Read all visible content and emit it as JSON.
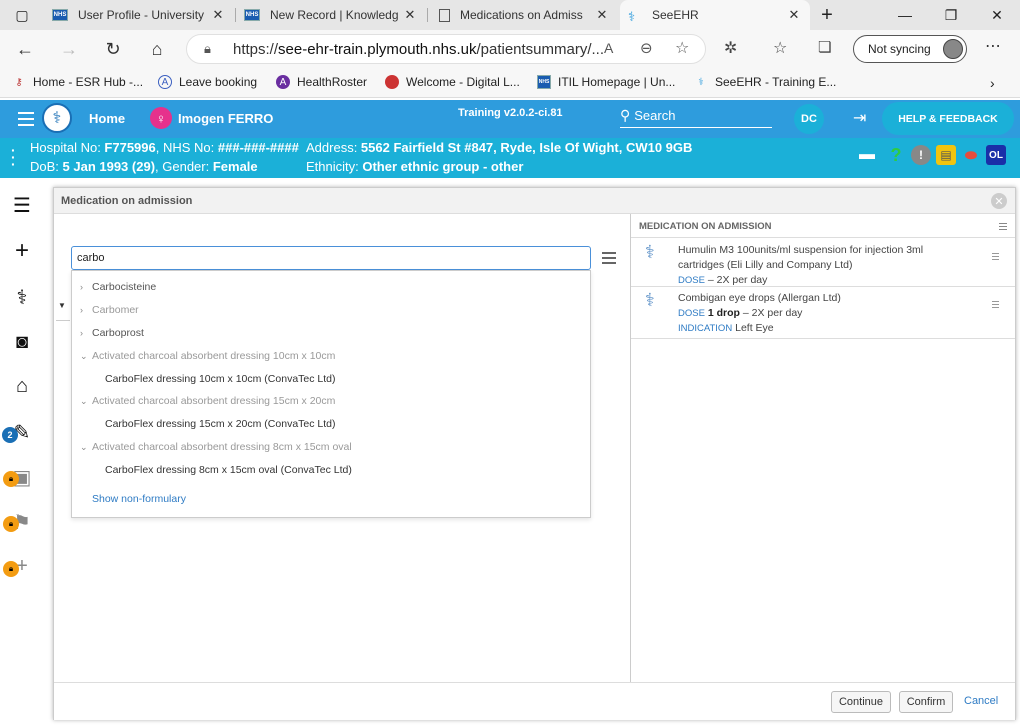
{
  "browser": {
    "tabs": [
      {
        "title": "User Profile - University",
        "favicon": "nhs-icon"
      },
      {
        "title": "New Record | Knowledg",
        "favicon": "nhs-icon"
      },
      {
        "title": "Medications on Admiss",
        "favicon": "page-icon"
      },
      {
        "title": "SeeEHR",
        "favicon": "seeehr-icon"
      }
    ],
    "url_prefix": "https://",
    "url_host": "see-ehr-train.plymouth.nhs.uk",
    "url_path": "/patientsummary/...",
    "sync_label": "Not syncing",
    "bookmarks": [
      "Home - ESR Hub -...",
      "Leave booking",
      "HealthRoster",
      "Welcome - Digital L...",
      "ITIL Homepage | Un...",
      "SeeEHR - Training E..."
    ]
  },
  "app": {
    "home_label": "Home",
    "patient_name": "Imogen FERRO",
    "version": "Training v2.0.2-ci.81",
    "search_label": "Search",
    "user_initials": "DC",
    "help_label": "HELP & FEEDBACK",
    "accent": "#2e9cdd",
    "banner_color": "#1bb0d8"
  },
  "banner": {
    "hospital_label": "Hospital No: ",
    "hospital_no": "F775996",
    "nhs_label": ", NHS No: ",
    "nhs_no": "###-###-####",
    "address_label": "Address: ",
    "address": "5562 Fairfield St #847, Ryde, Isle Of Wight, CW10 9GB",
    "dob_label": "DoB: ",
    "dob": "5 Jan 1993 (29)",
    "gender_label": ", Gender: ",
    "gender": "Female",
    "ethnicity_label": "Ethnicity: ",
    "ethnicity": "Other ethnic group - other",
    "ol_badge": "OL"
  },
  "sidebar": {
    "badge_count": "2"
  },
  "modal": {
    "title": "Medication on admission",
    "search_value": "carbo",
    "results": [
      {
        "label": "Carbocisteine",
        "kind": "group-collapsed"
      },
      {
        "label": "Carbomer",
        "kind": "group-collapsed-grey"
      },
      {
        "label": "Carboprost",
        "kind": "group-collapsed"
      },
      {
        "label": "Activated charcoal absorbent dressing 10cm x 10cm",
        "kind": "group-expanded"
      },
      {
        "label": "CarboFlex dressing 10cm x 10cm (ConvaTec Ltd)",
        "kind": "item"
      },
      {
        "label": "Activated charcoal absorbent dressing 15cm x 20cm",
        "kind": "group-expanded"
      },
      {
        "label": "CarboFlex dressing 15cm x 20cm (ConvaTec Ltd)",
        "kind": "item"
      },
      {
        "label": "Activated charcoal absorbent dressing 8cm x 15cm oval",
        "kind": "group-expanded"
      },
      {
        "label": "CarboFlex dressing 8cm x 15cm oval (ConvaTec Ltd)",
        "kind": "item"
      }
    ],
    "non_formulary": "Show non-formulary",
    "right_header": "MEDICATION ON ADMISSION",
    "meds": [
      {
        "name_line1": "Humulin M3 100units/ml suspension for injection 3ml",
        "name_line2": "cartridges (Eli Lilly and Company Ltd)",
        "dose_label": "DOSE",
        "dose": " – 2X per day"
      },
      {
        "name_line1": "Combigan eye drops (Allergan Ltd)",
        "dose_label": "DOSE",
        "dose_bold": " 1 drop",
        "dose": " – 2X per day",
        "indication_label": "INDICATION",
        "indication": " Left Eye"
      }
    ],
    "buttons": {
      "continue": "Continue",
      "confirm": "Confirm",
      "cancel": "Cancel"
    }
  }
}
